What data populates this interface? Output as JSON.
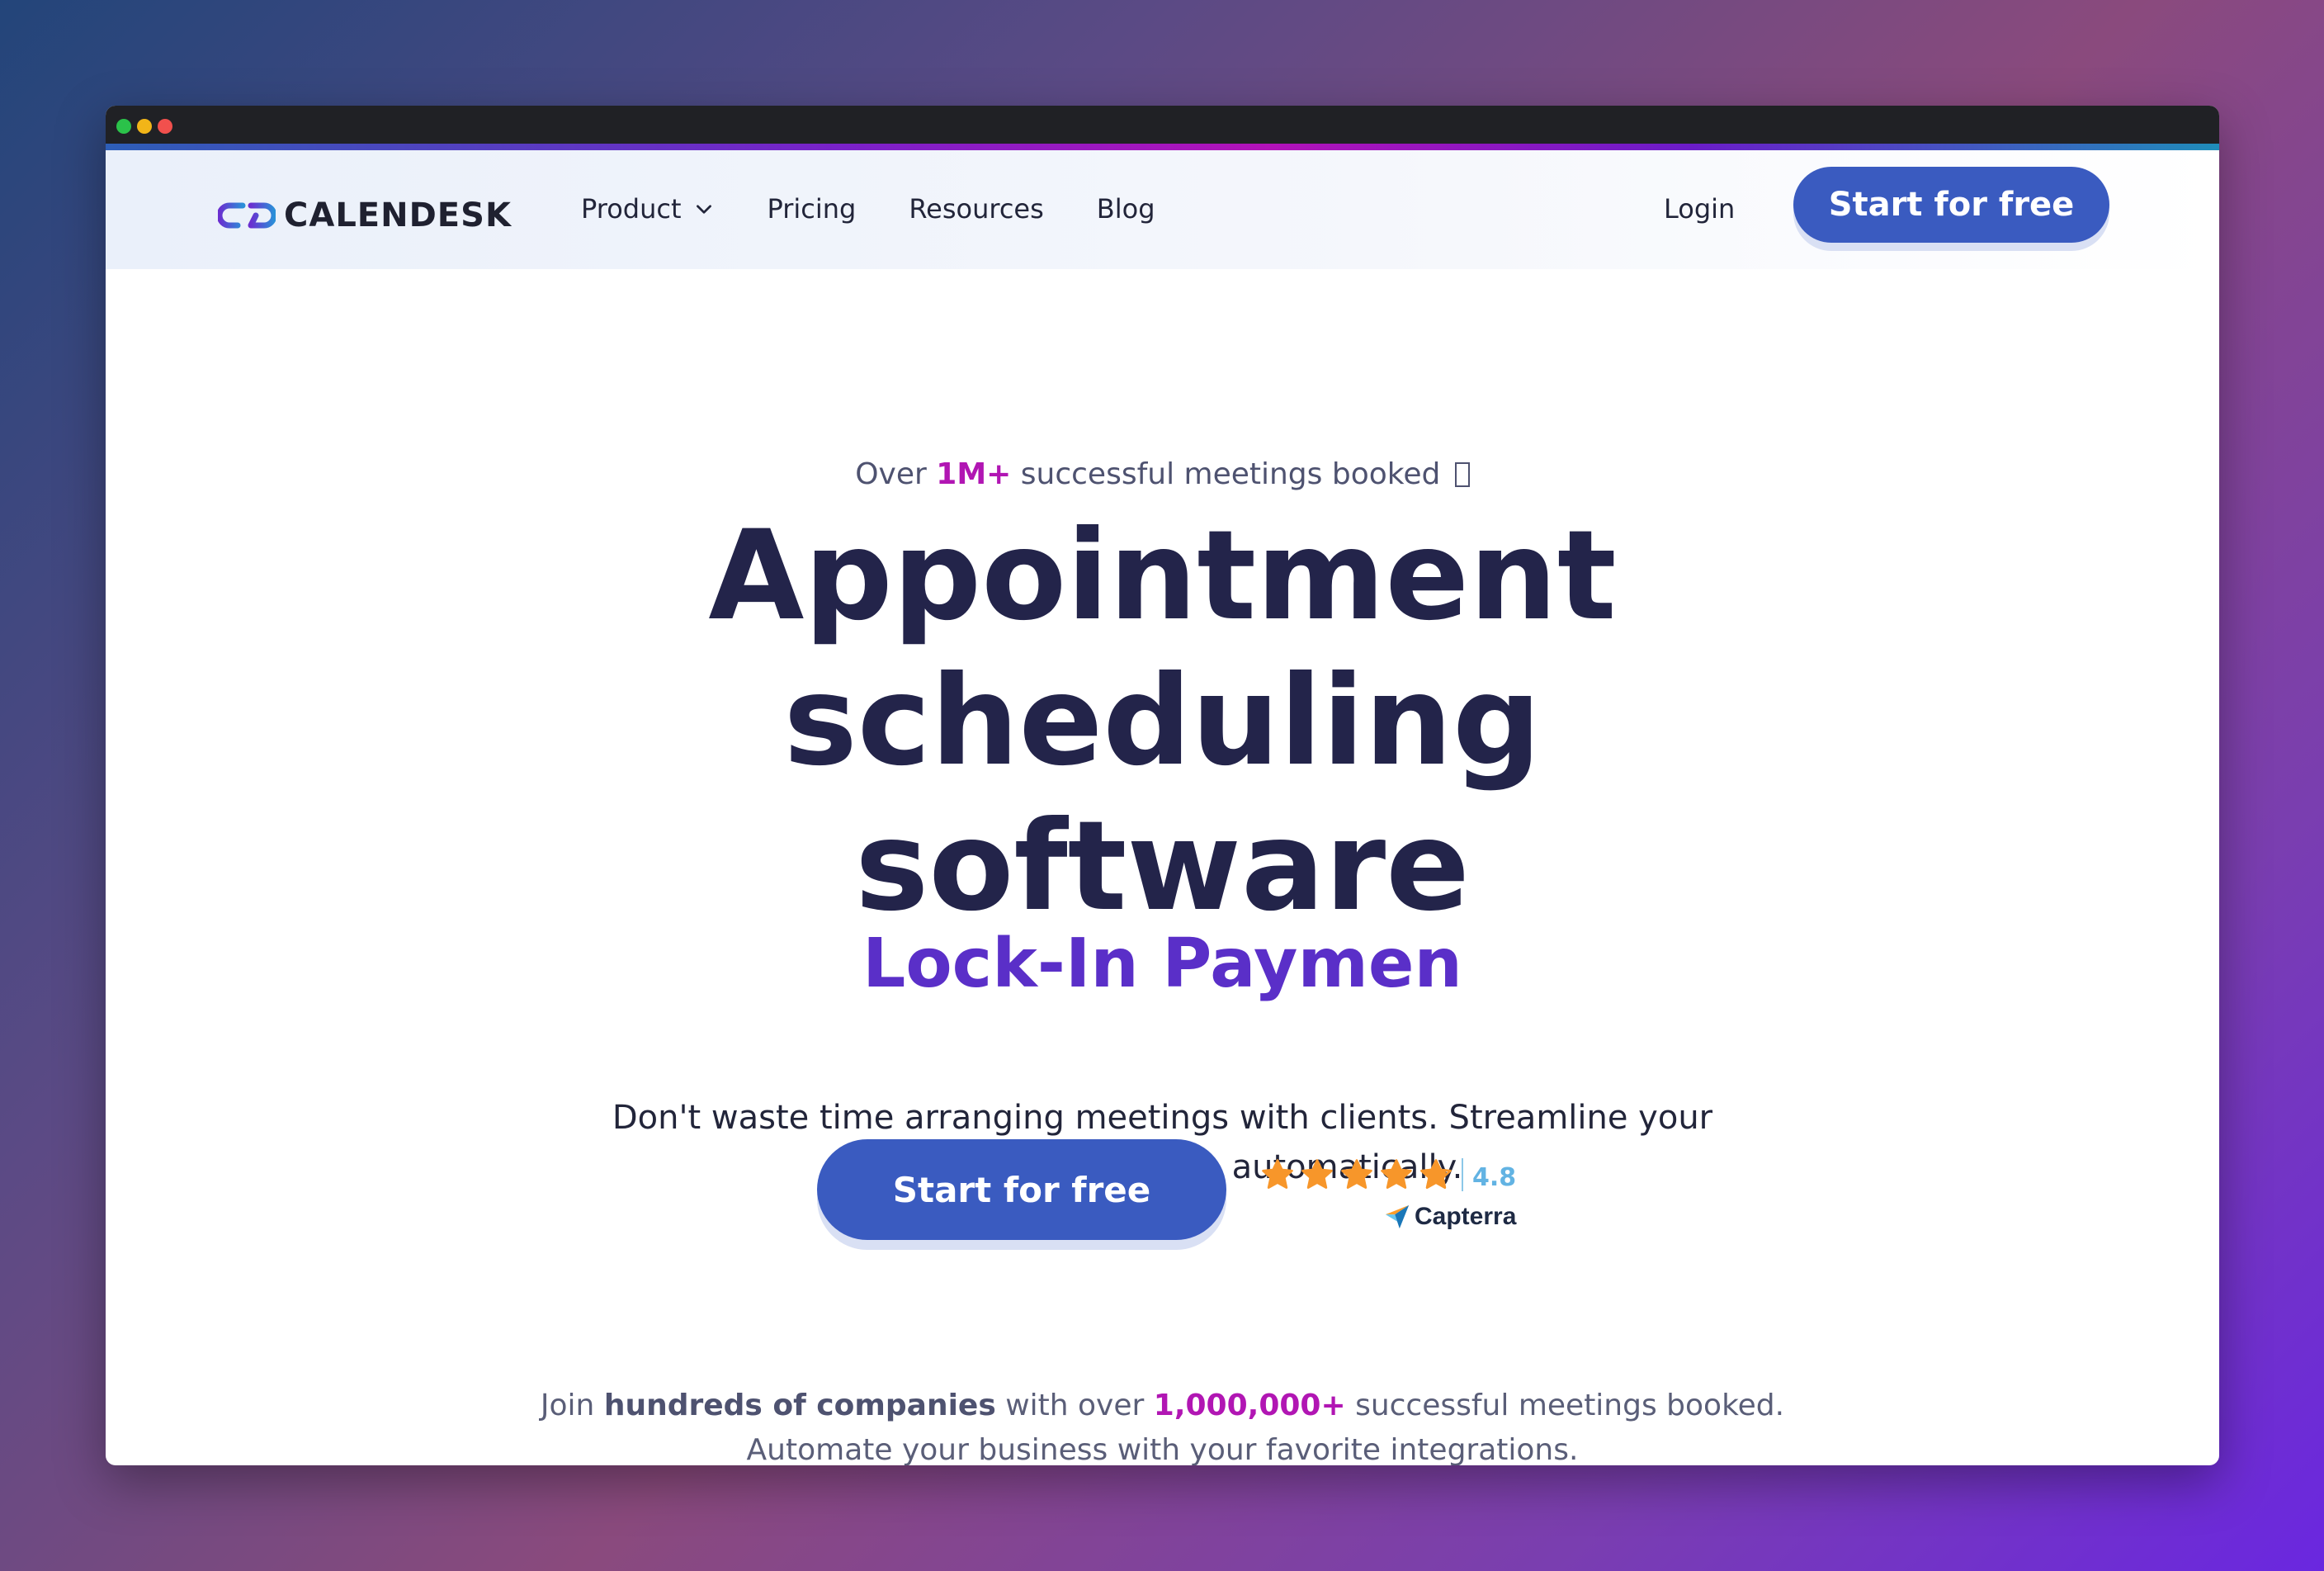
{
  "window": {
    "traffic_lights": [
      "green",
      "yellow",
      "red"
    ]
  },
  "nav": {
    "logo_text": "CALENDESK",
    "links": [
      {
        "label": "Product",
        "has_dropdown": true
      },
      {
        "label": "Pricing"
      },
      {
        "label": "Resources"
      },
      {
        "label": "Blog"
      }
    ],
    "login_label": "Login",
    "cta_label": "Start for free"
  },
  "hero": {
    "eyebrow_prefix": "Over ",
    "eyebrow_highlight": "1M+",
    "eyebrow_suffix": " successful meetings booked",
    "headline_line1": "Appointment",
    "headline_line2": "scheduling",
    "headline_line3": "software",
    "typed_text": "Lock-In Paymen",
    "subtitle_line1": "Don't waste time arranging meetings with clients. Streamline your",
    "subtitle_line2": "company's workflow - automatically.",
    "cta_label": "Start for free"
  },
  "rating": {
    "stars": 4.8,
    "value": "4.8",
    "source": "Capterra"
  },
  "social_proof": {
    "prefix": "Join ",
    "bold": "hundreds of companies",
    "middle": " with over ",
    "highlight": "1,000,000+",
    "suffix": " successful meetings booked.",
    "line2": "Automate your business with your favorite integrations."
  },
  "colors": {
    "primary": "#3a5bc0",
    "heading": "#23244a",
    "highlight": "#b116b3",
    "typed": "#5a2fc8",
    "star": "#f7962a",
    "rating": "#62b3e3"
  }
}
